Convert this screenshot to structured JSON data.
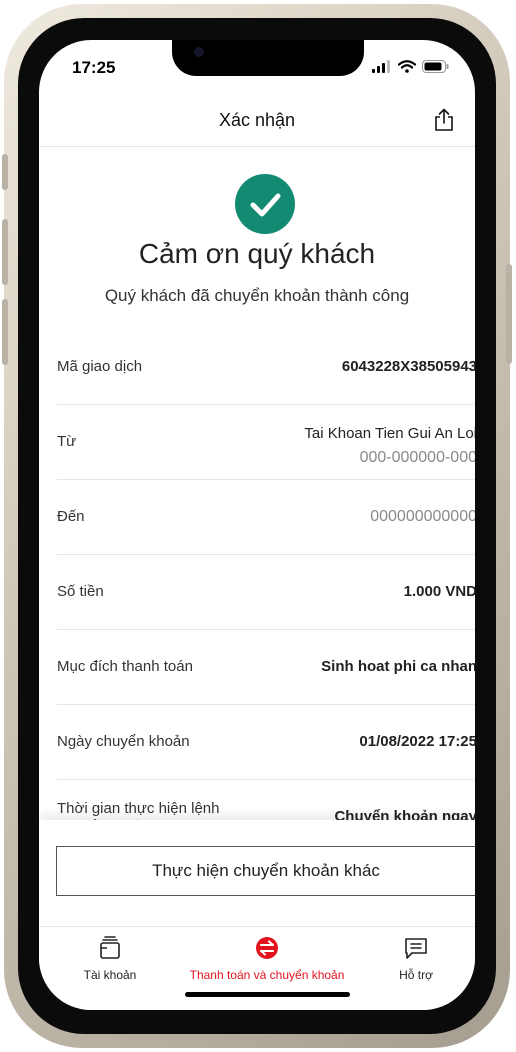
{
  "status_bar": {
    "time": "17:25"
  },
  "header": {
    "title": "Xác nhận"
  },
  "confirmation": {
    "title": "Cảm ơn quý khách",
    "subtitle": "Quý khách đã chuyển khoản thành công"
  },
  "details": [
    {
      "label": "Mã giao dịch",
      "value": "6043228X38505943"
    },
    {
      "label": "Từ",
      "value": "Tai Khoan Tien Gui An Loi",
      "value2": "000-000000-000"
    },
    {
      "label": "Đến",
      "value": "000000000000"
    },
    {
      "label": "Số tiền",
      "value": "1.000 VND"
    },
    {
      "label": "Mục đích thanh toán",
      "value": "Sinh hoat phi ca nhan"
    },
    {
      "label": "Ngày chuyển khoản",
      "value": "01/08/2022 17:25"
    },
    {
      "label": "Thời gian thực hiện lệnh chuyển khoản",
      "value": "Chuyển khoản ngay"
    }
  ],
  "action_button": "Thực hiện chuyển khoản khác",
  "tabs": [
    {
      "label": "Tài khoản",
      "icon": "wallet-icon"
    },
    {
      "label": "Thanh toán và chuyển khoản",
      "icon": "transfer-icon",
      "active": true
    },
    {
      "label": "Hỗ trợ",
      "icon": "chat-icon"
    }
  ],
  "colors": {
    "success": "#138a72",
    "active_tab": "#e1141e",
    "inactive_tab": "#222222"
  }
}
